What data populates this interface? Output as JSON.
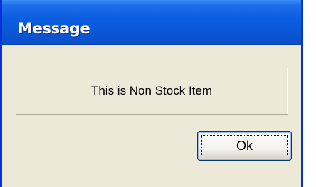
{
  "window": {
    "title": "Message"
  },
  "message": {
    "text": "This is Non Stock Item"
  },
  "buttons": {
    "ok_mnemonic": "O",
    "ok_rest": "k"
  },
  "colors": {
    "titlebar_blue": "#0a5ce0",
    "frame_blue": "#0831d9",
    "dialog_face": "#ece9d8"
  }
}
